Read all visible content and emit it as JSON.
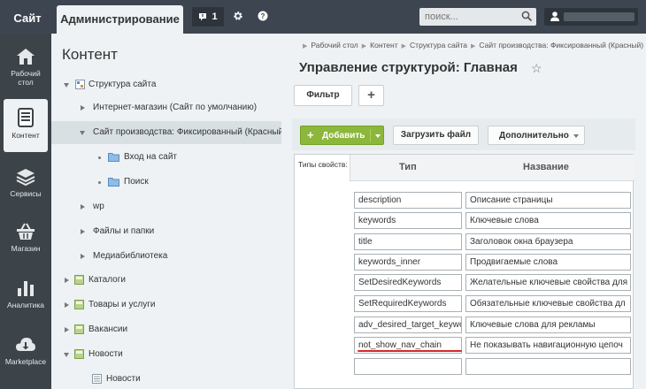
{
  "topbar": {
    "site_tab": "Сайт",
    "admin_tab": "Администрирование",
    "notifications_count": "1",
    "search_placeholder": "поиск...",
    "search_value": ""
  },
  "sidebar": {
    "items": [
      {
        "label_line1": "Рабочий",
        "label_line2": "стол",
        "icon": "home-icon"
      },
      {
        "label_line1": "Контент",
        "label_line2": "",
        "icon": "content-icon"
      },
      {
        "label_line1": "Сервисы",
        "label_line2": "",
        "icon": "layers-icon"
      },
      {
        "label_line1": "Магазин",
        "label_line2": "",
        "icon": "basket-icon"
      },
      {
        "label_line1": "Аналитика",
        "label_line2": "",
        "icon": "analytics-icon"
      },
      {
        "label_line1": "Marketplace",
        "label_line2": "",
        "icon": "cloud-download-icon"
      }
    ]
  },
  "tree": {
    "title": "Контент",
    "items": [
      {
        "label": "Структура сайта",
        "expander": "down",
        "icon": "structure-icon"
      },
      {
        "label": "Интернет-магазин (Сайт по умолчанию)",
        "expander": "right",
        "icon": ""
      },
      {
        "label": "Сайт производства: Фиксированный (Красный)",
        "expander": "down",
        "icon": ""
      },
      {
        "label": "Вход на сайт",
        "expander": "dot",
        "icon": "folder-icon"
      },
      {
        "label": "Поиск",
        "expander": "dot",
        "icon": "folder-icon"
      },
      {
        "label": "wp",
        "expander": "right",
        "icon": ""
      },
      {
        "label": "Файлы и папки",
        "expander": "right",
        "icon": ""
      },
      {
        "label": "Медиабиблиотека",
        "expander": "right",
        "icon": ""
      },
      {
        "label": "Каталоги",
        "expander": "right",
        "icon": "catalog-icon"
      },
      {
        "label": "Товары и услуги",
        "expander": "right",
        "icon": "catalog-icon"
      },
      {
        "label": "Вакансии",
        "expander": "right",
        "icon": "catalog-icon"
      },
      {
        "label": "Новости",
        "expander": "down",
        "icon": "catalog-icon"
      },
      {
        "label": "Новости",
        "expander": "",
        "icon": "list-icon"
      }
    ]
  },
  "main": {
    "breadcrumb": [
      "Рабочий стол",
      "Контент",
      "Структура сайта",
      "Сайт производства: Фиксированный (Красный)"
    ],
    "title": "Управление структурой: Главная",
    "filter_label": "Фильтр",
    "add_label": "Добавить",
    "upload_label": "Загрузить файл",
    "more_label": "Дополнительно",
    "props_label": "Типы свойств:",
    "col_type": "Тип",
    "col_name": "Название",
    "properties": [
      {
        "type": "description",
        "name": "Описание страницы"
      },
      {
        "type": "keywords",
        "name": "Ключевые слова"
      },
      {
        "type": "title",
        "name": "Заголовок окна браузера"
      },
      {
        "type": "keywords_inner",
        "name": "Продвигаемые слова"
      },
      {
        "type": "SetDesiredKeywords",
        "name": "Желательные ключевые свойства для"
      },
      {
        "type": "SetRequiredKeywords",
        "name": "Обязательные ключевые свойства дл"
      },
      {
        "type": "adv_desired_target_keywo",
        "name": "Ключевые слова для рекламы"
      },
      {
        "type": "not_show_nav_chain",
        "name": "Не показывать навигационную цепоч"
      },
      {
        "type": "",
        "name": ""
      }
    ]
  },
  "colors": {
    "topbar": "#3d4550",
    "panel": "#eef2f4",
    "add_button": "#8bb83a",
    "highlight_underline": "#d62828"
  }
}
